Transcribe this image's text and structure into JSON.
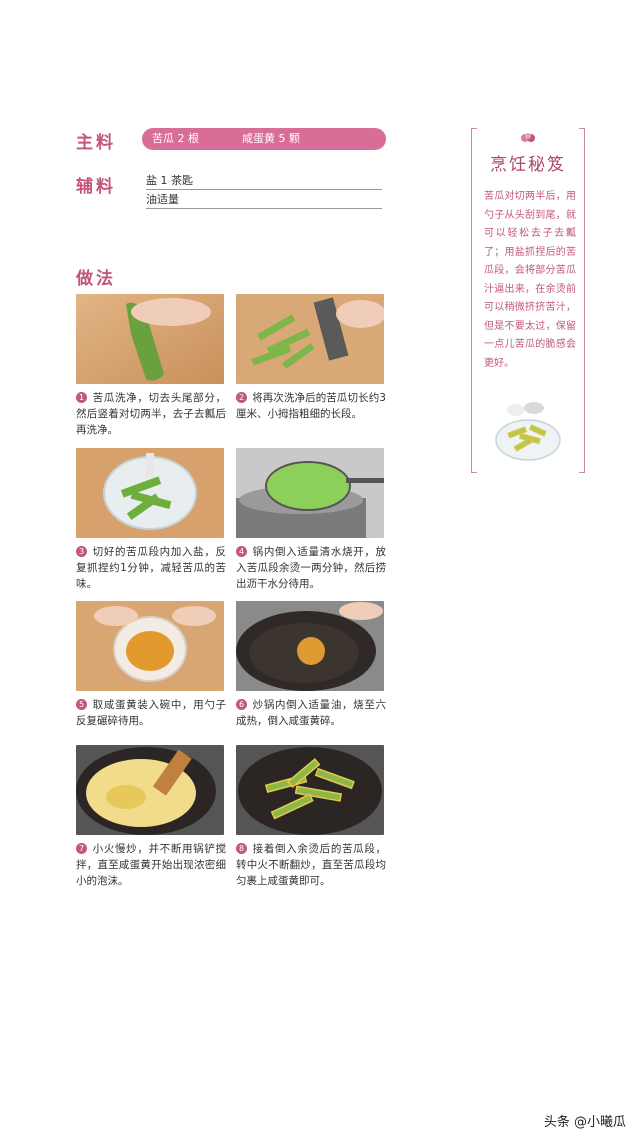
{
  "ingredients": {
    "main_title": "主料",
    "main_items": [
      "苦瓜 2 根",
      "咸蛋黄 5 颗"
    ],
    "aux_title": "辅料",
    "aux_items": [
      "盐 1 茶匙",
      "油适量"
    ]
  },
  "method": {
    "title": "做法",
    "steps": [
      {
        "num": "1",
        "text": "苦瓜洗净，切去头尾部分，然后竖着对切两半，去子去瓤后再洗净。"
      },
      {
        "num": "2",
        "text": "将再次洗净后的苦瓜切长约3厘米、小拇指粗细的长段。"
      },
      {
        "num": "3",
        "text": "切好的苦瓜段内加入盐，反复抓捏约1分钟，减轻苦瓜的苦味。"
      },
      {
        "num": "4",
        "text": "锅内倒入适量清水烧开，放入苦瓜段余烫一两分钟，然后捞出沥干水分待用。"
      },
      {
        "num": "5",
        "text": "取咸蛋黄装入碗中，用勺子反复碾碎待用。"
      },
      {
        "num": "6",
        "text": "炒锅内倒入适量油，烧至六成热，倒入咸蛋黄碎。"
      },
      {
        "num": "7",
        "text": "小火慢炒，并不断用锅铲搅拌，直至咸蛋黄开始出现浓密细小的泡沫。"
      },
      {
        "num": "8",
        "text": "接着倒入余烫后的苦瓜段，转中火不断翻炒，直至苦瓜段均匀裹上咸蛋黄即可。"
      }
    ]
  },
  "tips": {
    "title": "烹饪秘笈",
    "text": "苦瓜对切两半后，用勺子从头刮到尾，就可以轻松去子去瓤了；用盐抓捏后的苦瓜段，会将部分苦瓜汁逼出来，在余烫前可以稍微挤挤苦汁，但是不要太过，保留一点儿苦瓜的脆感会更好。"
  },
  "footer": {
    "watermark": "头条 @小曦瓜"
  },
  "colors": {
    "accent": "#c2567f",
    "bar": "#d86d98"
  }
}
